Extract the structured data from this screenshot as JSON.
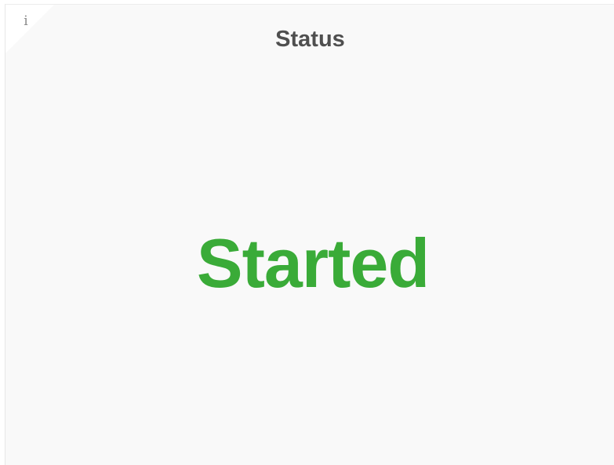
{
  "panel": {
    "title": "Status",
    "info_icon": "info-icon",
    "info_glyph": "i",
    "value": "Started",
    "value_color": "#3aab38"
  }
}
